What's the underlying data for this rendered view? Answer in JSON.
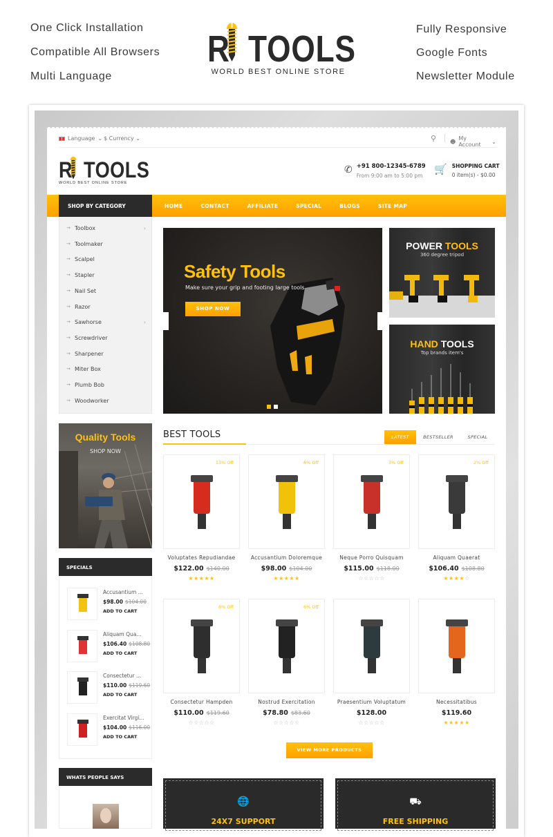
{
  "promo": {
    "features_left": [
      "One Click Installation",
      "Compatible All Browsers",
      "Multi Language"
    ],
    "features_right": [
      "Fully Responsive",
      "Google Fonts",
      "Newsletter Module"
    ],
    "logo_text": "RITOOLS",
    "logo_tagline": "WORLD BEST ONLINE STORE"
  },
  "topbar": {
    "language": "Language",
    "currency": "$ Currency",
    "account": "My Account"
  },
  "header": {
    "logo_text": "RITOOLS",
    "logo_tagline": "WORLD BEST ONLINE STORE",
    "phone": "+91 800-12345-6789",
    "hours": "From 9:00 am to 5:00 pm",
    "cart_title": "SHOPPING CART",
    "cart_summary": "0 item(s) - $0.00"
  },
  "nav": {
    "category_label": "SHOP BY CATEGORY",
    "items": [
      "HOME",
      "CONTACT",
      "AFFILIATE",
      "SPECIAL",
      "BLOGS",
      "SITE MAP"
    ]
  },
  "categories": [
    {
      "label": "Toolbox",
      "has_sub": true
    },
    {
      "label": "Toolmaker",
      "has_sub": false
    },
    {
      "label": "Scalpel",
      "has_sub": false
    },
    {
      "label": "Stapler",
      "has_sub": false
    },
    {
      "label": "Nail Set",
      "has_sub": false
    },
    {
      "label": "Razor",
      "has_sub": false
    },
    {
      "label": "Sawhorse",
      "has_sub": true
    },
    {
      "label": "Screwdriver",
      "has_sub": false
    },
    {
      "label": "Sharpener",
      "has_sub": false
    },
    {
      "label": "Miter Box",
      "has_sub": false
    },
    {
      "label": "Plumb Bob",
      "has_sub": false
    },
    {
      "label": "Woodworker",
      "has_sub": false
    }
  ],
  "slider": {
    "title": "Safety Tools",
    "subtitle": "Make sure your grip and footing large tools",
    "button": "SHOP NOW",
    "slide_count": 2,
    "active_slide": 1
  },
  "banners": {
    "power": {
      "word1": "POWER",
      "word2": "TOOLS",
      "sub": "360 degree tripod"
    },
    "hand": {
      "word1": "HAND",
      "word2": "TOOLS",
      "sub": "Top brands item's"
    }
  },
  "quality_banner": {
    "title": "Quality Tools",
    "cta": "SHOP NOW"
  },
  "specials": {
    "title": "SPECIALS",
    "add_label": "ADD TO CART",
    "items": [
      {
        "name": "Accusantium ...",
        "price": "$98.00",
        "old": "$104.00"
      },
      {
        "name": "Aliquam Qua...",
        "price": "$106.40",
        "old": "$108.80"
      },
      {
        "name": "Consectetur ...",
        "price": "$110.00",
        "old": "$119.60"
      },
      {
        "name": "Exercitat Virgi...",
        "price": "$104.00",
        "old": "$116.00"
      }
    ]
  },
  "testimonials": {
    "title": "WHATS PEOPLE SAYS"
  },
  "best_tools": {
    "title": "BEST TOOLS",
    "tabs": [
      "LATEST",
      "BESTSELLER",
      "SPECIAL"
    ],
    "active_tab": "LATEST",
    "products": [
      {
        "name": "Voluptates Repudiandae",
        "price": "$122.00",
        "old": "$140.00",
        "off": "13% Off",
        "rating": 5
      },
      {
        "name": "Accusantium Doloremque",
        "price": "$98.00",
        "old": "$104.00",
        "off": "6% Off",
        "rating": 5
      },
      {
        "name": "Neque Porro Quisquam",
        "price": "$115.00",
        "old": "$118.00",
        "off": "3% Off",
        "rating": 0
      },
      {
        "name": "Aliquam Quaerat",
        "price": "$106.40",
        "old": "$108.80",
        "off": "2% Off",
        "rating": 4
      },
      {
        "name": "Consectetur Hampden",
        "price": "$110.00",
        "old": "$119.60",
        "off": "8% Off",
        "rating": 0
      },
      {
        "name": "Nostrud Exercitation",
        "price": "$78.80",
        "old": "$83.60",
        "off": "6% Off",
        "rating": 0
      },
      {
        "name": "Praesentium Voluptatum",
        "price": "$128.00",
        "old": "",
        "off": "",
        "rating": 0
      },
      {
        "name": "Necessitatibus",
        "price": "$119.60",
        "old": "",
        "off": "",
        "rating": 5
      }
    ],
    "view_more": "VIEW MORE PRODUCTS"
  },
  "services": [
    {
      "icon": "globe-phone-icon",
      "title": "24X7 SUPPORT"
    },
    {
      "icon": "truck-icon",
      "title": "FREE SHIPPING"
    }
  ],
  "colors": {
    "accent": "#ffc10a",
    "accent_dark": "#ff9f00",
    "dark": "#2b2b2b"
  }
}
